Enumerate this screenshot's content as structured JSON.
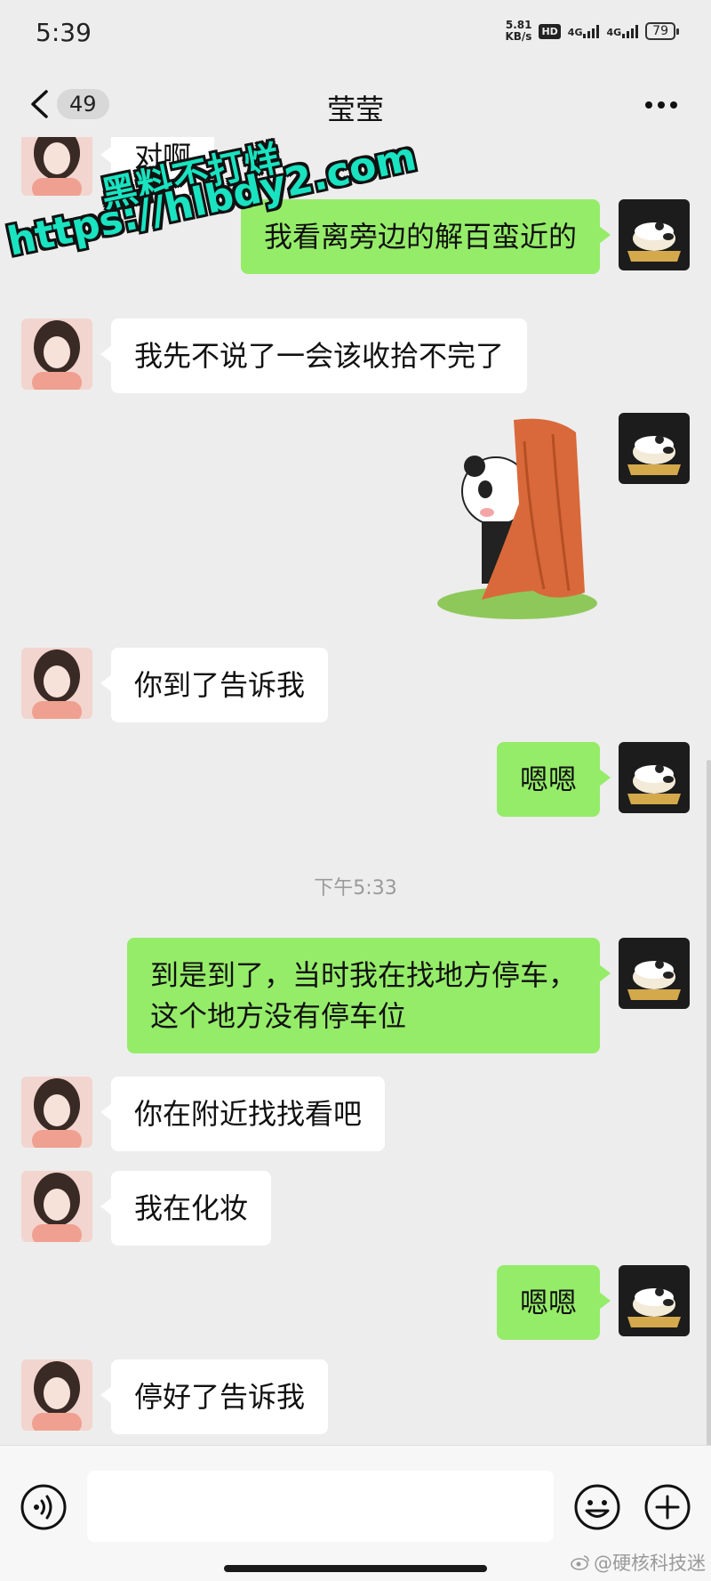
{
  "status_bar": {
    "time": "5:39",
    "speed_value": "5.81",
    "speed_unit": "KB/s",
    "hd_badge": "HD",
    "signal1_label": "4G",
    "signal2_label": "4G",
    "battery": "79"
  },
  "header": {
    "back_icon": "chevron-left-icon",
    "unread_count": "49",
    "title": "莹莹",
    "more_icon": "more-dots-icon"
  },
  "watermark": {
    "line1": "黑料不打烊",
    "line2": "https://hlbdy2.com"
  },
  "messages": [
    {
      "side": "in",
      "text": "对啊"
    },
    {
      "side": "out",
      "text": "我看离旁边的解百蛮近的"
    },
    {
      "side": "in",
      "text": "我先不说了一会该收拾不完了"
    },
    {
      "side": "out",
      "type": "sticker",
      "sticker": "panda-hiding-sticker"
    },
    {
      "side": "in",
      "text": "你到了告诉我"
    },
    {
      "side": "out",
      "text": "嗯嗯"
    },
    {
      "type": "timestamp",
      "text": "下午5:33"
    },
    {
      "side": "out",
      "lines": [
        "到是到了，当时我在找地方停车，",
        "这个地方没有停车位"
      ]
    },
    {
      "side": "in",
      "text": "你在附近找找看吧"
    },
    {
      "side": "in",
      "text": "我在化妆"
    },
    {
      "side": "out",
      "text": "嗯嗯"
    },
    {
      "side": "in",
      "text": "停好了告诉我"
    }
  ],
  "input_bar": {
    "voice_icon": "voice-icon",
    "input_value": "",
    "emoji_icon": "emoji-icon",
    "plus_icon": "plus-icon"
  },
  "credit": {
    "icon": "weibo-icon",
    "text": "@硬核科技迷"
  },
  "colors": {
    "background": "#ededed",
    "outgoing_bubble": "#95ec69",
    "incoming_bubble": "#ffffff",
    "watermark": "#19e3c0"
  }
}
